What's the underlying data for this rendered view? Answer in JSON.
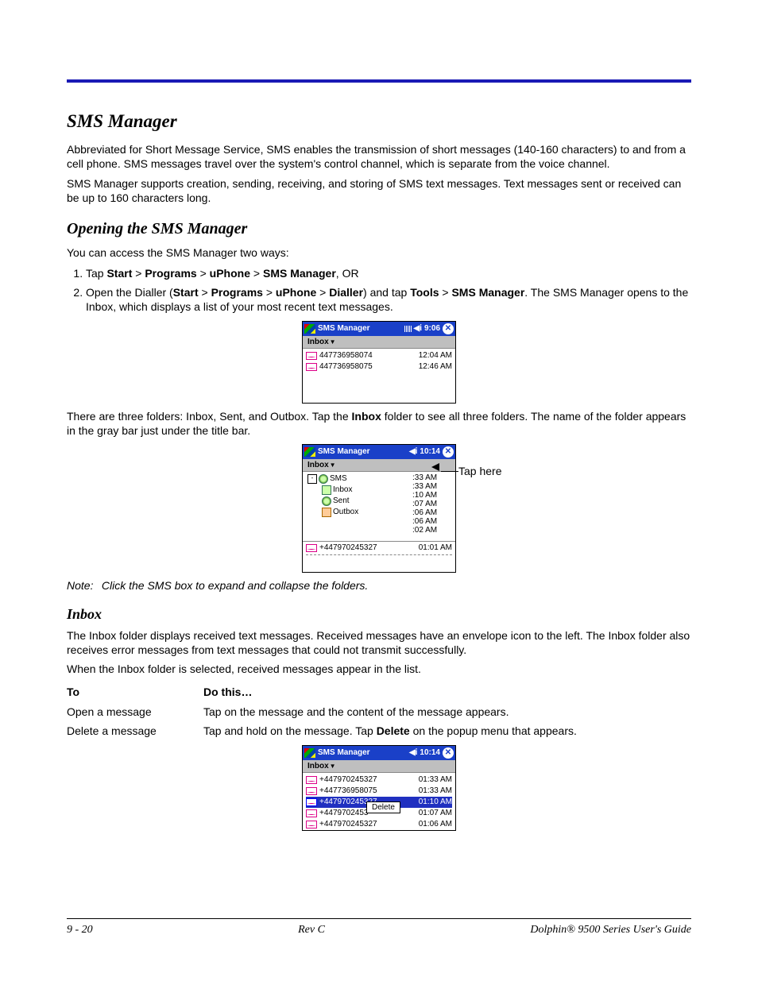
{
  "headings": {
    "sms_manager": "SMS Manager",
    "opening": "Opening the SMS Manager",
    "inbox": "Inbox"
  },
  "paras": {
    "intro1": "Abbreviated for Short Message Service, SMS enables the transmission of short messages (140-160 characters) to and from a cell phone. SMS messages travel over the system's control channel, which is separate from the voice channel.",
    "intro2": "SMS Manager supports creation, sending, receiving, and storing of SMS text messages. Text messages sent or received can be up to 160 characters long.",
    "open_intro": "You can access the SMS Manager two ways:",
    "folders": "There are three folders: Inbox, Sent, and Outbox. Tap the ",
    "folders_bold": "Inbox",
    "folders_after": " folder to see all three folders. The name of the folder appears in the gray bar just under the title bar.",
    "note_label": "Note:",
    "note_body": "Click the SMS box to expand and collapse the folders.",
    "inbox1": "The Inbox folder displays received text messages. Received messages have an envelope icon to the left. The Inbox folder also receives error messages from text messages that could not transmit successfully.",
    "inbox2": "When the Inbox folder is selected, received messages appear in the list."
  },
  "list1": {
    "prefix": "Tap ",
    "path": [
      "Start",
      ">",
      "Programs",
      ">",
      "uPhone",
      ">",
      "SMS Manager"
    ],
    "suffix": ", OR"
  },
  "list2": {
    "prefix": "Open the Dialler (",
    "path1": [
      "Start",
      ">",
      "Programs",
      ">",
      "uPhone",
      ">",
      "Dialler"
    ],
    "mid": ") and tap ",
    "path2": [
      "Tools",
      ">",
      "SMS Manager"
    ],
    "suffix": ". The SMS Manager opens to the Inbox, which displays a list of your most recent text messages."
  },
  "shot1": {
    "title": "SMS Manager",
    "clock": "9:06",
    "menu": "Inbox",
    "rows": [
      {
        "num": "447736958074",
        "time": "12:04 AM"
      },
      {
        "num": "447736958075",
        "time": "12:46 AM"
      }
    ]
  },
  "shot2": {
    "title": "SMS Manager",
    "clock": "10:14",
    "menu": "Inbox",
    "tree": {
      "root": "SMS",
      "items": [
        "Inbox",
        "Sent",
        "Outbox"
      ]
    },
    "times": [
      ":33 AM",
      ":33 AM",
      ":10 AM",
      ":07 AM",
      ":06 AM",
      ":06 AM",
      ":02 AM"
    ],
    "tail_num": "+447970245327",
    "tail_time": "01:01 AM",
    "callout": "Tap here"
  },
  "shot3": {
    "title": "SMS Manager",
    "clock": "10:14",
    "menu": "Inbox",
    "rows": [
      {
        "num": "+447970245327",
        "time": "01:33 AM"
      },
      {
        "num": "+447736958075",
        "time": "01:33 AM"
      },
      {
        "num": "+447970245327",
        "time": "01:10 AM",
        "selected": true
      },
      {
        "num": "+4479702453",
        "time": "01:07 AM"
      },
      {
        "num": "+447970245327",
        "time": "01:06 AM"
      }
    ],
    "popup": "Delete"
  },
  "actions": {
    "head_to": "To",
    "head_do": "Do this…",
    "r1a": "Open a message",
    "r1b": "Tap on the message and the content of the message appears.",
    "r2a": "Delete a message",
    "r2b_pre": "Tap and hold on the message. Tap ",
    "r2b_bold": "Delete",
    "r2b_post": " on the popup menu that appears."
  },
  "footer": {
    "left": "9 - 20",
    "center": "Rev C",
    "right": "Dolphin® 9500 Series User's Guide"
  }
}
